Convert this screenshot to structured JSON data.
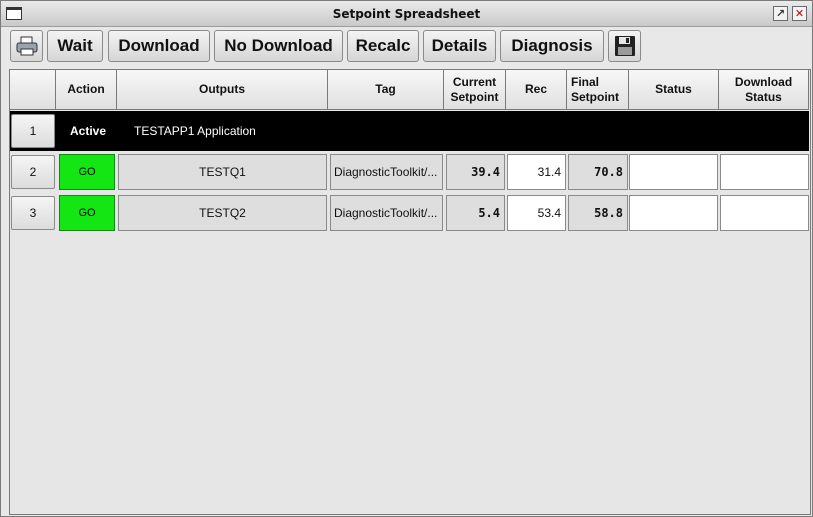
{
  "window": {
    "title": "Setpoint Spreadsheet"
  },
  "toolbar": {
    "print_icon": "printer-icon",
    "wait_label": "Wait",
    "download_label": "Download",
    "no_download_label": "No Download",
    "recalc_label": "Recalc",
    "details_label": "Details",
    "diagnosis_label": "Diagnosis",
    "save_icon": "floppy-disk-icon"
  },
  "columns": {
    "action": "Action",
    "outputs": "Outputs",
    "tag": "Tag",
    "current": "Current Setpoint",
    "rec": "Rec",
    "final": "Final Setpoint",
    "status": "Status",
    "download_status": "Download Status"
  },
  "app_row": {
    "num": "1",
    "state": "Active",
    "name": "TESTAPP1 Application"
  },
  "rows": [
    {
      "num": "2",
      "action": "GO",
      "output": "TESTQ1",
      "tag": "DiagnosticToolkit/...",
      "current": "39.4",
      "rec": "31.4",
      "final": "70.8",
      "status": "",
      "download_status": ""
    },
    {
      "num": "3",
      "action": "GO",
      "output": "TESTQ2",
      "tag": "DiagnosticToolkit/...",
      "current": "5.4",
      "rec": "53.4",
      "final": "58.8",
      "status": "",
      "download_status": ""
    }
  ],
  "colors": {
    "go": "#14e614",
    "active_row": "#000000"
  }
}
